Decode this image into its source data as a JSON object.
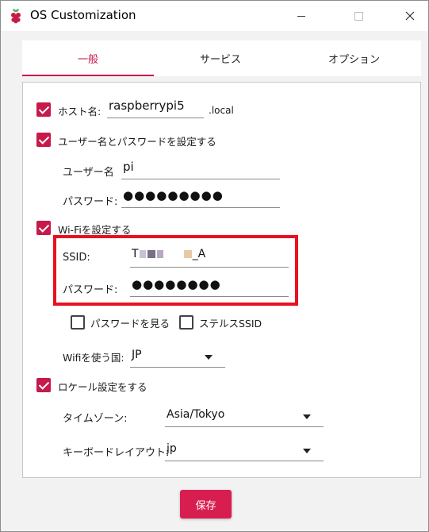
{
  "window": {
    "title": "OS Customization"
  },
  "tabs": [
    {
      "label": "一般"
    },
    {
      "label": "サービス"
    },
    {
      "label": "オプション"
    }
  ],
  "hostname": {
    "checkbox_label": "ホスト名:",
    "value": "raspberrypi5",
    "suffix": ".local",
    "checked": true
  },
  "user": {
    "checkbox_label": "ユーザー名とパスワードを設定する",
    "checked": true,
    "username_label": "ユーザー名",
    "username_value": "pi",
    "password_label": "パスワード:",
    "password_value": "●●●●●●●●●"
  },
  "wifi": {
    "checkbox_label": "Wi-Fiを設定する",
    "checked": true,
    "ssid_label": "SSID:",
    "ssid_prefix": "T",
    "ssid_suffix": "_A",
    "password_label": "パスワード:",
    "password_value": "●●●●●●●●",
    "show_password_label": "パスワードを見る",
    "stealth_label": "ステルスSSID",
    "country_label": "Wifiを使う国:",
    "country_value": "JP"
  },
  "locale": {
    "checkbox_label": "ロケール設定をする",
    "checked": true,
    "timezone_label": "タイムゾーン:",
    "timezone_value": "Asia/Tokyo",
    "keyboard_label": "キーボードレイアウト:",
    "keyboard_value": "jp"
  },
  "footer": {
    "save_label": "保存"
  },
  "colors": {
    "accent": "#c51a4a",
    "button": "#d81e50",
    "highlight": "#e8121e"
  }
}
